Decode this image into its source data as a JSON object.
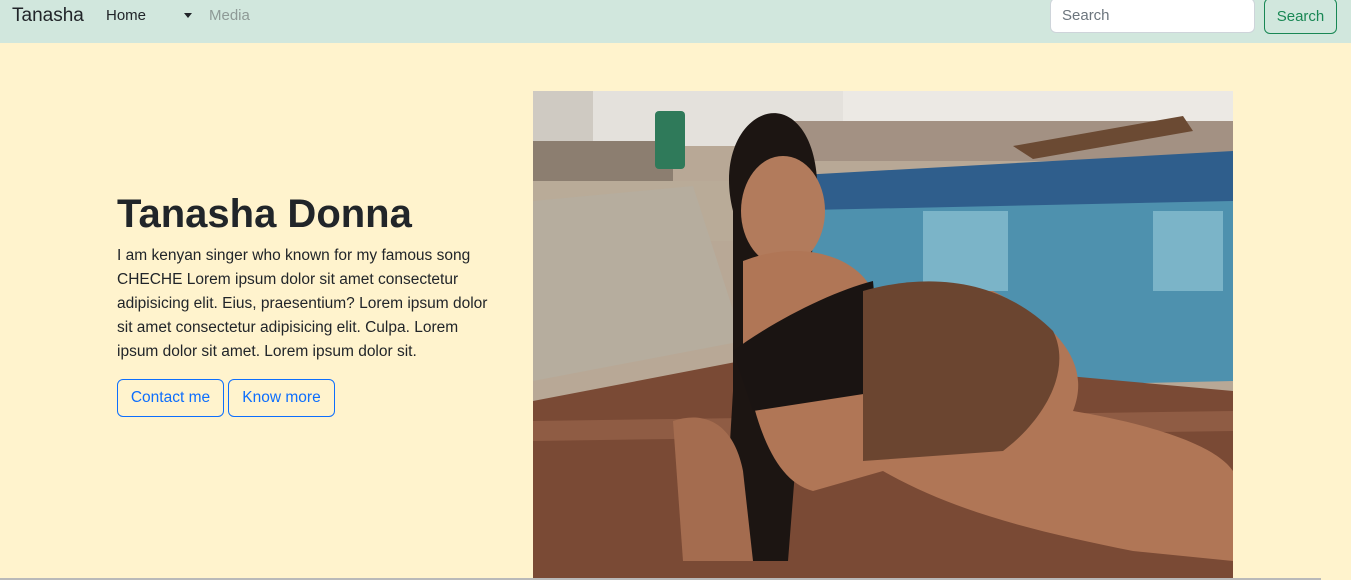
{
  "navbar": {
    "brand": "Tanasha",
    "home_label": "Home",
    "media_label": "Media",
    "search_placeholder": "Search",
    "search_button": "Search"
  },
  "hero": {
    "title": "Tanasha Donna",
    "text": "I am kenyan singer who known for my famous song CHECHE Lorem ipsum dolor sit amet consectetur adipisicing elit. Eius, praesentium? Lorem ipsum dolor sit amet consectetur adipisicing elit. Culpa. Lorem ipsum dolor sit amet. Lorem ipsum dolor sit.",
    "contact_button": "Contact me",
    "more_button": "Know more"
  },
  "colors": {
    "navbar_bg": "#d1e7dd",
    "page_bg": "#fff3cd",
    "primary": "#0d6efd",
    "success": "#198754"
  }
}
